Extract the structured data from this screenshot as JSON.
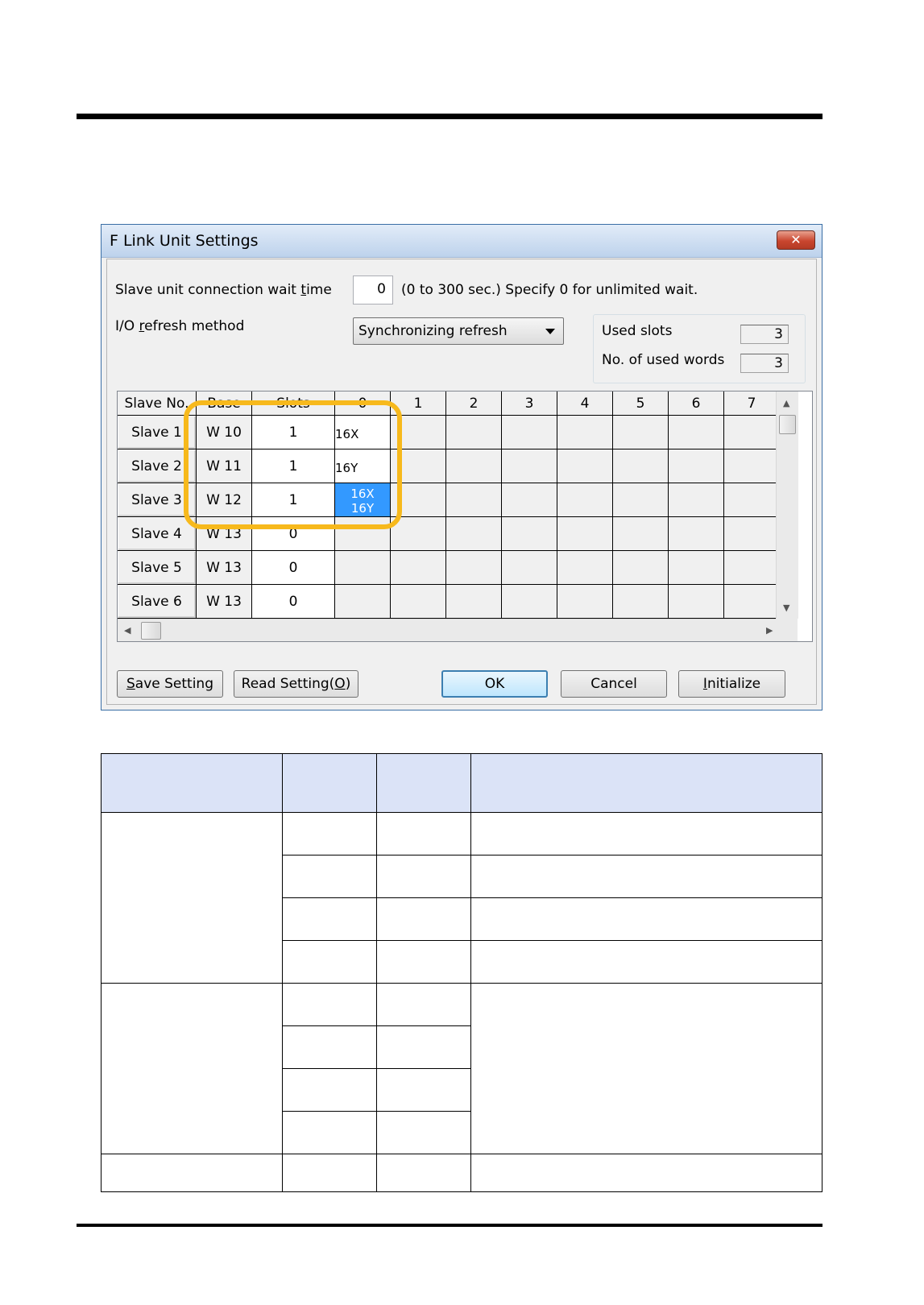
{
  "window": {
    "title": "F Link Unit Settings",
    "close_glyph": "✕"
  },
  "settings": {
    "wait_time_label_pre": "Slave unit connection wait ",
    "wait_time_label_accel": "t",
    "wait_time_label_post": "ime",
    "wait_time_value": "0",
    "wait_time_hint": "(0 to 300 sec.) Specify 0 for unlimited wait.",
    "refresh_label_pre": "I/O ",
    "refresh_label_accel": "r",
    "refresh_label_post": "efresh method",
    "refresh_method_value": "Synchronizing refresh",
    "used_slots_label": "Used slots",
    "used_slots_value": "3",
    "used_words_label": "No. of used words",
    "used_words_value": "3"
  },
  "grid": {
    "headers": [
      "Slave No.",
      "Base",
      "Slots",
      "0",
      "1",
      "2",
      "3",
      "4",
      "5",
      "6",
      "7"
    ],
    "rows": [
      {
        "slave": "Slave 1",
        "base": "W 10",
        "slots": "1",
        "slot0": [
          "16X"
        ],
        "selected": false
      },
      {
        "slave": "Slave 2",
        "base": "W 11",
        "slots": "1",
        "slot0": [
          "16Y"
        ],
        "selected": false
      },
      {
        "slave": "Slave 3",
        "base": "W 12",
        "slots": "1",
        "slot0": [
          "16X",
          "16Y"
        ],
        "selected": true
      },
      {
        "slave": "Slave 4",
        "base": "W 13",
        "slots": "0",
        "slot0": [],
        "selected": false
      },
      {
        "slave": "Slave 5",
        "base": "W 13",
        "slots": "0",
        "slot0": [],
        "selected": false
      },
      {
        "slave": "Slave 6",
        "base": "W 13",
        "slots": "0",
        "slot0": [],
        "selected": false
      }
    ]
  },
  "buttons": {
    "save_accel": "S",
    "save_rest": "ave Setting",
    "read_pre": "Read Setting(",
    "read_accel": "O",
    "read_post": ")",
    "ok": "OK",
    "cancel": "Cancel",
    "init_accel": "I",
    "init_rest": "nitialize"
  },
  "colors": {
    "highlight": "#f7b91c",
    "selection": "#3399ff",
    "table_header": "#dbe3f7"
  }
}
